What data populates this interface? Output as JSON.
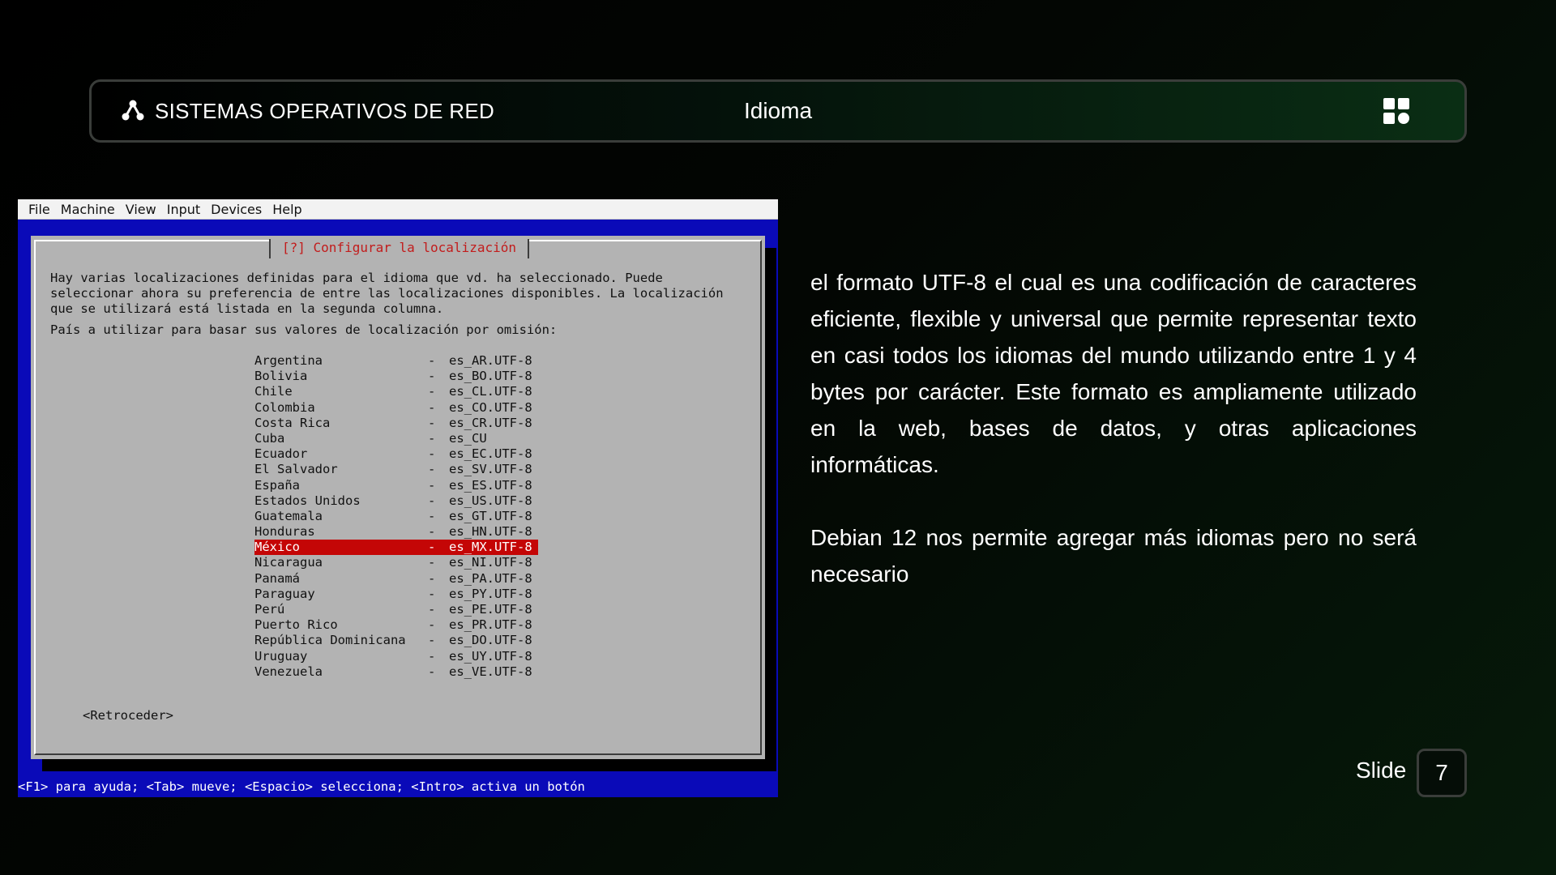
{
  "header": {
    "brand_title": "SISTEMAS OPERATIVOS DE RED",
    "section_title": "Idioma",
    "brand_icon": "network-icon",
    "menu_icon": "grid-icon"
  },
  "vm": {
    "menu": [
      "File",
      "Machine",
      "View",
      "Input",
      "Devices",
      "Help"
    ],
    "dialog_title": "[?] Configurar la localización",
    "description": "Hay varias localizaciones definidas para el idioma que vd. ha seleccionado. Puede\nseleccionar ahora su preferencia de entre las localizaciones disponibles. La localización\nque se utilizará está listada en la segunda columna.",
    "prompt": "País a utilizar para basar sus valores de localización por omisión:",
    "locales": [
      {
        "country": "Argentina",
        "code": "es_AR.UTF-8"
      },
      {
        "country": "Bolivia",
        "code": "es_BO.UTF-8"
      },
      {
        "country": "Chile",
        "code": "es_CL.UTF-8"
      },
      {
        "country": "Colombia",
        "code": "es_CO.UTF-8"
      },
      {
        "country": "Costa Rica",
        "code": "es_CR.UTF-8"
      },
      {
        "country": "Cuba",
        "code": "es_CU"
      },
      {
        "country": "Ecuador",
        "code": "es_EC.UTF-8"
      },
      {
        "country": "El Salvador",
        "code": "es_SV.UTF-8"
      },
      {
        "country": "España",
        "code": "es_ES.UTF-8"
      },
      {
        "country": "Estados Unidos",
        "code": "es_US.UTF-8"
      },
      {
        "country": "Guatemala",
        "code": "es_GT.UTF-8"
      },
      {
        "country": "Honduras",
        "code": "es_HN.UTF-8"
      },
      {
        "country": "México",
        "code": "es_MX.UTF-8",
        "selected": true
      },
      {
        "country": "Nicaragua",
        "code": "es_NI.UTF-8"
      },
      {
        "country": "Panamá",
        "code": "es_PA.UTF-8"
      },
      {
        "country": "Paraguay",
        "code": "es_PY.UTF-8"
      },
      {
        "country": "Perú",
        "code": "es_PE.UTF-8"
      },
      {
        "country": "Puerto Rico",
        "code": "es_PR.UTF-8"
      },
      {
        "country": "República Dominicana",
        "code": "es_DO.UTF-8"
      },
      {
        "country": "Uruguay",
        "code": "es_UY.UTF-8"
      },
      {
        "country": "Venezuela",
        "code": "es_VE.UTF-8"
      }
    ],
    "separator": "-",
    "back_button": "<Retroceder>",
    "status_bar": "<F1> para ayuda; <Tab> mueve; <Espacio> selecciona; <Intro> activa un botón"
  },
  "content": {
    "paragraph_1": "el formato UTF-8 el cual es una codificación de caracteres eficiente, flexible y universal que permite representar texto en casi todos los idiomas del mundo utilizando entre 1 y 4 bytes por carácter. Este formato es ampliamente utilizado en la web, bases de datos, y otras aplicaciones informáticas.",
    "paragraph_2": "Debian 12 nos permite agregar más idiomas pero no será necesario"
  },
  "footer": {
    "slide_label": "Slide",
    "slide_number": "7"
  },
  "colors": {
    "selection": "#c40606",
    "vm_background": "#0a0ab8",
    "dialog_background": "#b3b3b3",
    "dialog_title": "#c21c1c"
  }
}
